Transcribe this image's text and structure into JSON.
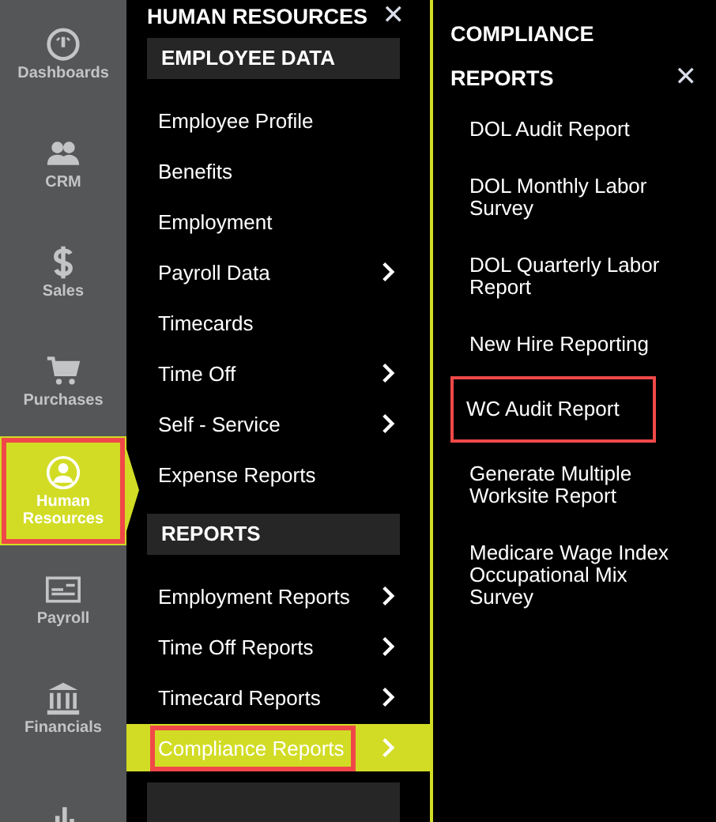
{
  "rail": [
    {
      "label": "Dashboards",
      "selected": false,
      "outlined": false
    },
    {
      "label": "CRM",
      "selected": false,
      "outlined": false
    },
    {
      "label": "Sales",
      "selected": false,
      "outlined": false
    },
    {
      "label": "Purchases",
      "selected": false,
      "outlined": false
    },
    {
      "label": "Human Resources",
      "selected": true,
      "outlined": true
    },
    {
      "label": "Payroll",
      "selected": false,
      "outlined": false
    },
    {
      "label": "Financials",
      "selected": false,
      "outlined": false
    },
    {
      "selected": false,
      "outlined": false
    }
  ],
  "menu": {
    "title": "HUMAN RESOURCES",
    "close": "✕",
    "sections": [
      {
        "title": "EMPLOYEE DATA",
        "items": [
          {
            "label": "Employee Profile",
            "submenu": false,
            "selected": false,
            "outlined": false
          },
          {
            "label": "Benefits",
            "submenu": false,
            "selected": false,
            "outlined": false
          },
          {
            "label": "Employment",
            "submenu": false,
            "selected": false,
            "outlined": false
          },
          {
            "label": "Payroll Data",
            "submenu": true,
            "selected": false,
            "outlined": false
          },
          {
            "label": "Timecards",
            "submenu": false,
            "selected": false,
            "outlined": false
          },
          {
            "label": "Time Off",
            "submenu": true,
            "selected": false,
            "outlined": false
          },
          {
            "label": "Self - Service",
            "submenu": true,
            "selected": false,
            "outlined": false
          },
          {
            "label": "Expense Reports",
            "submenu": false,
            "selected": false,
            "outlined": false
          }
        ]
      },
      {
        "title": "REPORTS",
        "items": [
          {
            "label": "Employment Reports",
            "submenu": true,
            "selected": false,
            "outlined": false
          },
          {
            "label": "Time Off Reports",
            "submenu": true,
            "selected": false,
            "outlined": false
          },
          {
            "label": "Timecard Reports",
            "submenu": true,
            "selected": false,
            "outlined": false
          },
          {
            "label": "Compliance Reports",
            "submenu": true,
            "selected": true,
            "outlined": true
          }
        ]
      }
    ]
  },
  "submenu": {
    "title": "COMPLIANCE REPORTS",
    "close": "✕",
    "items": [
      {
        "label": "DOL Audit Report",
        "outlined": false
      },
      {
        "label": "DOL Monthly Labor Survey",
        "outlined": false
      },
      {
        "label": "DOL Quarterly Labor Report",
        "outlined": false
      },
      {
        "label": "New Hire Reporting",
        "outlined": false
      },
      {
        "label": "WC Audit Report",
        "outlined": true
      },
      {
        "label": "Generate Multiple Worksite Report",
        "outlined": false
      },
      {
        "label": "Medicare Wage Index Occupational Mix Survey",
        "outlined": false
      }
    ]
  }
}
